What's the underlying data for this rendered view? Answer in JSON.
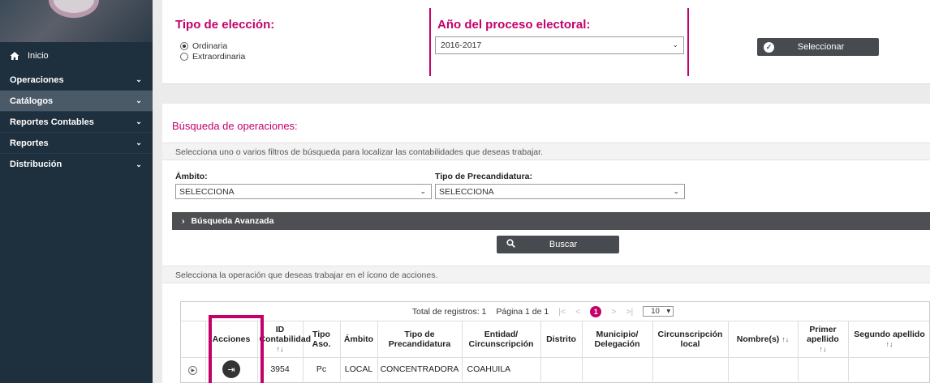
{
  "sidebar": {
    "home_label": "Inicio",
    "items": [
      {
        "label": "Operaciones",
        "active": false
      },
      {
        "label": "Catálogos",
        "active": true
      },
      {
        "label": "Reportes Contables",
        "active": false
      },
      {
        "label": "Reportes",
        "active": false
      },
      {
        "label": "Distribución",
        "active": false
      }
    ]
  },
  "eleccion": {
    "title": "Tipo de elección:",
    "options": [
      {
        "label": "Ordinaria",
        "checked": true
      },
      {
        "label": "Extraordinaria",
        "checked": false
      }
    ]
  },
  "proceso": {
    "title": "Año del proceso electoral:",
    "selected": "2016-2017"
  },
  "seleccionar_button": "Seleccionar",
  "busqueda": {
    "title": "Búsqueda de operaciones:",
    "hint": "Selecciona uno o varios filtros de búsqueda para localizar las contabilidades que deseas trabajar.",
    "ambito_label": "Ámbito",
    "ambito_value": "SELECCIONA",
    "precandidatura_label": "Tipo de Precandidatura",
    "precandidatura_value": "SELECCIONA",
    "advanced_label": "Búsqueda Avanzada",
    "buscar_button": "Buscar",
    "operation_hint": "Selecciona la operación que deseas trabajar en el ícono de acciones."
  },
  "pager": {
    "total": "Total de registros: 1",
    "page": "Página 1 de 1",
    "first": "|<",
    "prev": "<",
    "current": "1",
    "next": ">",
    "last": ">|",
    "page_size": "10"
  },
  "table": {
    "columns": [
      {
        "label": "",
        "sort": ""
      },
      {
        "label": "Acciones",
        "sort": ""
      },
      {
        "label": "ID Contabilidad",
        "sort": "↑↓"
      },
      {
        "label": "Tipo Aso.",
        "sort": ""
      },
      {
        "label": "Ámbito",
        "sort": ""
      },
      {
        "label": "Tipo de Precandidatura",
        "sort": ""
      },
      {
        "label": "Entidad/ Circunscripción",
        "sort": ""
      },
      {
        "label": "Distrito",
        "sort": ""
      },
      {
        "label": "Municipio/ Delegación",
        "sort": ""
      },
      {
        "label": "Circunscripción local",
        "sort": ""
      },
      {
        "label": "Nombre(s)",
        "sort": "↑↓"
      },
      {
        "label": "Primer apellido",
        "sort": "↑↓"
      },
      {
        "label": "Segundo apellido",
        "sort": "↑↓"
      }
    ],
    "rows": [
      [
        "",
        "",
        "3954",
        "Pc",
        "LOCAL",
        "CONCENTRADORA",
        "COAHUILA",
        "",
        "",
        "",
        "",
        "",
        ""
      ]
    ]
  }
}
